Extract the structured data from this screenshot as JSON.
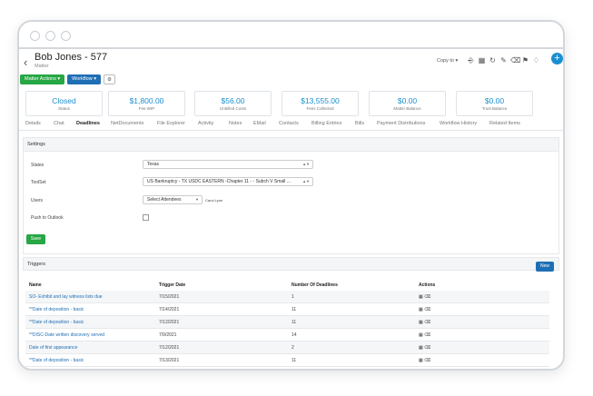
{
  "header": {
    "title": "Bob Jones - 577",
    "subtitle": "Matter",
    "copy_to": "Copy to",
    "add_symbol": "+"
  },
  "toolbar": {
    "matter_actions": "Matter Actions",
    "workflow": "Workflow",
    "gear": "⚙"
  },
  "cards": [
    {
      "value": "Closed",
      "label": "Status"
    },
    {
      "value": "$1,800.00",
      "label": "Fee WIP"
    },
    {
      "value": "$56.00",
      "label": "Unbilled Costs"
    },
    {
      "value": "$13,555.00",
      "label": "Fees Collected"
    },
    {
      "value": "$0.00",
      "label": "Matter Balance"
    },
    {
      "value": "$0.00",
      "label": "Trust Balance"
    }
  ],
  "tabs": [
    "Details",
    "Chat",
    "Deadlines",
    "NetDocuments",
    "File Explorer",
    "Activity",
    "Notes",
    "EMail",
    "Contacts",
    "Billing Entries",
    "Bills",
    "Payment Distributions",
    "Workflow History",
    "Related Items"
  ],
  "active_tab": "Deadlines",
  "settings": {
    "title": "Settings",
    "states_label": "States",
    "states_value": "Texas",
    "toolset_label": "ToolSet",
    "toolset_value": "US Bankruptcy - TX USDC EASTERN -Chapter 11 - - Subch V Small ...",
    "users_label": "Users",
    "users_value": "Select Attendees",
    "users_selected": "Carol Lynn",
    "push_label": "Push to Outlook",
    "save": "Save"
  },
  "triggers": {
    "title": "Triggers",
    "new": "New",
    "columns": [
      "Name",
      "Trigger Date",
      "Number Of Deadlines",
      "Actions"
    ],
    "rows": [
      {
        "name": "SO- Exhibit and lay witness lists due",
        "date": "7/15/2021",
        "count": "1"
      },
      {
        "name": "**Date of deposition - basic",
        "date": "7/14/2021",
        "count": "11"
      },
      {
        "name": "**Date of deposition - basic",
        "date": "7/12/2021",
        "count": "11"
      },
      {
        "name": "**DISC-Date written discovery served",
        "date": "7/9/2021",
        "count": "14"
      },
      {
        "name": "Date of first appearance",
        "date": "7/12/2021",
        "count": "2"
      },
      {
        "name": "**Date of deposition - basic",
        "date": "7/13/2021",
        "count": "11"
      }
    ]
  },
  "colors": {
    "accent": "#1a8fd0",
    "green": "#27a745",
    "blue": "#1f6fb5"
  }
}
